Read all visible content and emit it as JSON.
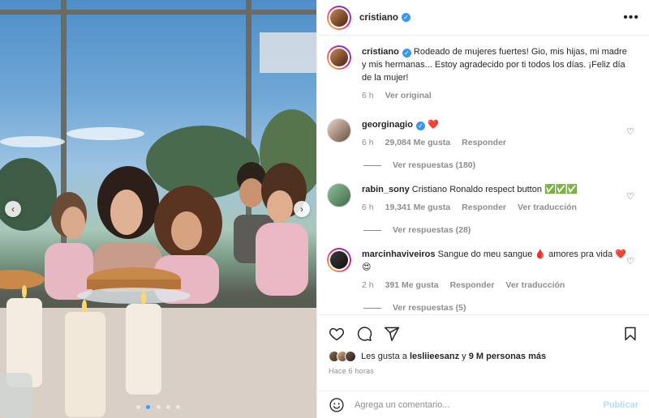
{
  "post": {
    "author": "cristiano",
    "more_label": "•••",
    "carousel": {
      "count": 5,
      "active": 1,
      "prev_label": "‹",
      "next_label": "›"
    }
  },
  "caption": {
    "user": "cristiano",
    "text": "Rodeado de mujeres fuertes! Gio, mis hijas, mi madre y mis hermanas... Estoy agradecido por ti todos los días. ¡Feliz día de la mujer!",
    "time": "6 h",
    "translate": "Ver original"
  },
  "comments": [
    {
      "user": "georginagio",
      "verified": true,
      "text": "❤️",
      "time": "6 h",
      "likes": "29,084 Me gusta",
      "reply": "Responder",
      "translate": "",
      "replies": "Ver respuestas (180)"
    },
    {
      "user": "rabin_sony",
      "verified": false,
      "text": "Cristiano Ronaldo respect button ✅✅✅",
      "time": "6 h",
      "likes": "19,341 Me gusta",
      "reply": "Responder",
      "translate": "Ver traducción",
      "replies": "Ver respuestas (28)"
    },
    {
      "user": "marcinhaviveiros",
      "verified": false,
      "text": "Sangue do meu sangue 🩸 amores pra vida ❤️😍",
      "time": "2 h",
      "likes": "391 Me gusta",
      "reply": "Responder",
      "translate": "Ver traducción",
      "replies": "Ver respuestas (5)"
    }
  ],
  "footer": {
    "likes_prefix": "Les gusta a ",
    "likes_user": "lesliieesanz",
    "likes_mid": " y ",
    "likes_rest": "9 M personas más",
    "time": "Hace 6 horas"
  },
  "add_comment": {
    "placeholder": "Agrega un comentario...",
    "post_label": "Publicar"
  },
  "icons": {
    "like": "heart-icon",
    "comment": "comment-icon",
    "share": "share-icon",
    "save": "bookmark-icon",
    "emoji": "emoji-icon",
    "verified": "verified-badge-icon",
    "more": "more-options-icon"
  },
  "colors": {
    "verified": "#3897f0",
    "publish_disabled": "#b2dffc",
    "carousel_active": "#3d9df6"
  }
}
